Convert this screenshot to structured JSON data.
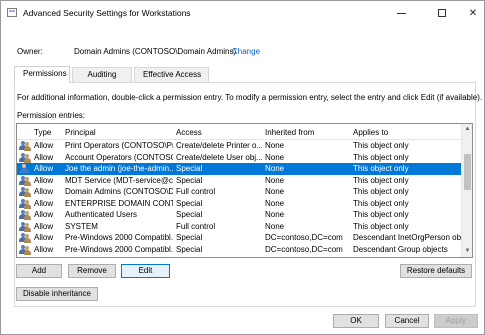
{
  "window": {
    "title": "Advanced Security Settings for Workstations"
  },
  "owner": {
    "label": "Owner:",
    "value": "Domain Admins (CONTOSO\\Domain Admins)",
    "change_link": "Change"
  },
  "tabs": [
    {
      "label": "Permissions",
      "active": true
    },
    {
      "label": "Auditing",
      "active": false
    },
    {
      "label": "Effective Access",
      "active": false
    }
  ],
  "info_text": "For additional information, double-click a permission entry. To modify a permission entry, select the entry and click Edit (if available).",
  "entries_label": "Permission entries:",
  "columns": {
    "type": "Type",
    "principal": "Principal",
    "access": "Access",
    "inherited": "Inherited from",
    "applies": "Applies to"
  },
  "entries": [
    {
      "icon": "group-icon",
      "type": "Allow",
      "principal": "Print Operators (CONTOSO\\Pri...",
      "access": "Create/delete Printer o...",
      "inherited": "None",
      "applies": "This object only"
    },
    {
      "icon": "group-icon",
      "type": "Allow",
      "principal": "Account Operators (CONTOSO...",
      "access": "Create/delete User obj...",
      "inherited": "None",
      "applies": "This object only"
    },
    {
      "icon": "user-icon",
      "type": "Allow",
      "principal": "Joe the admin (joe-the-admin...",
      "access": "Special",
      "inherited": "None",
      "applies": "This object only",
      "selected": true
    },
    {
      "icon": "group-icon",
      "type": "Allow",
      "principal": "MDT Service (MDT-service@co...",
      "access": "Special",
      "inherited": "None",
      "applies": "This object only"
    },
    {
      "icon": "group-icon",
      "type": "Allow",
      "principal": "Domain Admins (CONTOSO\\Do...",
      "access": "Full control",
      "inherited": "None",
      "applies": "This object only"
    },
    {
      "icon": "group-icon",
      "type": "Allow",
      "principal": "ENTERPRISE DOMAIN CONTR...",
      "access": "Special",
      "inherited": "None",
      "applies": "This object only"
    },
    {
      "icon": "group-icon",
      "type": "Allow",
      "principal": "Authenticated Users",
      "access": "Special",
      "inherited": "None",
      "applies": "This object only"
    },
    {
      "icon": "group-icon",
      "type": "Allow",
      "principal": "SYSTEM",
      "access": "Full control",
      "inherited": "None",
      "applies": "This object only"
    },
    {
      "icon": "group-icon",
      "type": "Allow",
      "principal": "Pre-Windows 2000 Compatibl...",
      "access": "Special",
      "inherited": "DC=contoso,DC=com",
      "applies": "Descendant InetOrgPerson obj..."
    },
    {
      "icon": "group-icon",
      "type": "Allow",
      "principal": "Pre-Windows 2000 Compatibl...",
      "access": "Special",
      "inherited": "DC=contoso,DC=com",
      "applies": "Descendant Group objects"
    }
  ],
  "buttons": {
    "add": "Add",
    "remove": "Remove",
    "edit": "Edit",
    "restore": "Restore defaults",
    "disable_inheritance": "Disable inheritance",
    "ok": "OK",
    "cancel": "Cancel",
    "apply": "Apply"
  },
  "colors": {
    "selection": "#0078d7",
    "link": "#0066cc"
  }
}
